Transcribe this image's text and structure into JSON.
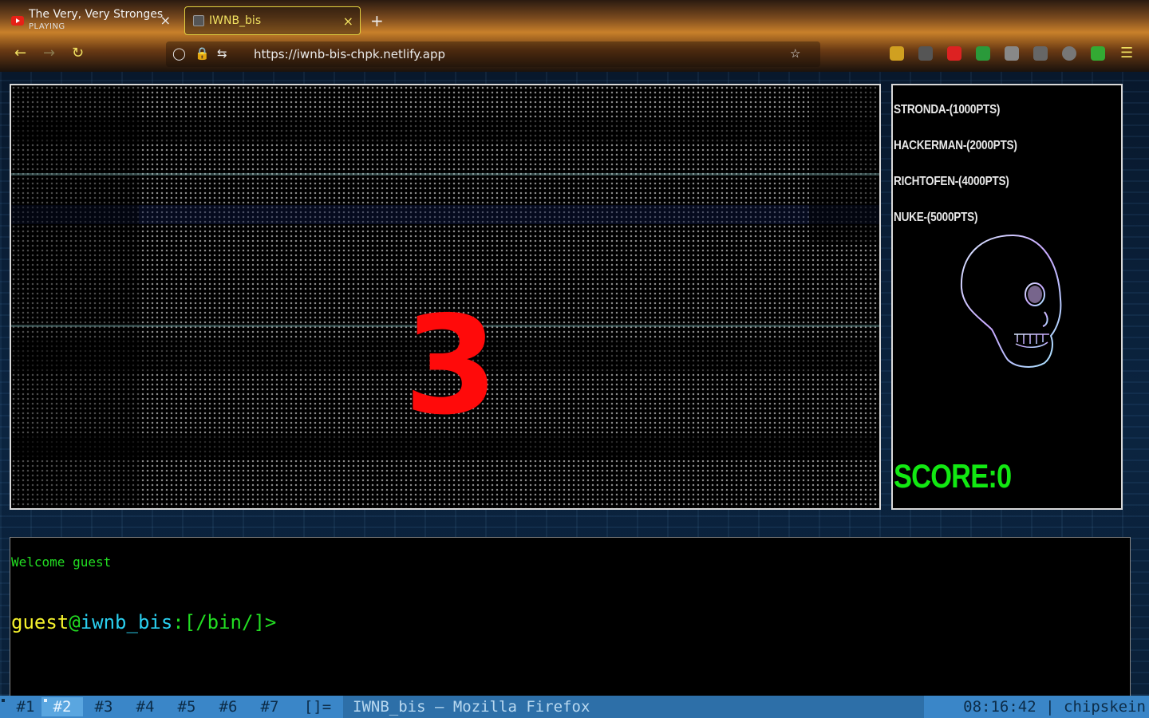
{
  "browser": {
    "tabs": [
      {
        "title": "The Very, Very Strongest!",
        "subtitle": "PLAYING",
        "close": "×"
      },
      {
        "title": "IWNB_bis",
        "close": "×"
      }
    ],
    "new_tab": "+",
    "url": "https://iwnb-bis-chpk.netlify.app"
  },
  "game": {
    "countdown": "3",
    "leaderboard": [
      "STRONDA-(1000PTS)",
      "HACKERMAN-(2000PTS)",
      "RICHTOFEN-(4000PTS)",
      "NUKE-(5000PTS)"
    ],
    "score": "SCORE:0"
  },
  "terminal": {
    "welcome": "Welcome guest",
    "prompt_user": "guest",
    "prompt_at": "@",
    "prompt_host": "iwnb_bis",
    "prompt_path": ":[/bin/]>"
  },
  "wm": {
    "workspaces": [
      "#1",
      "#2",
      "#3",
      "#4",
      "#5",
      "#6",
      "#7"
    ],
    "layout": "[]=",
    "window_title": "IWNB_bis — Mozilla Firefox",
    "clock": "08:16:42",
    "separator": "|",
    "user": "chipskein"
  },
  "colors": {
    "countdown": "#ff0a0a",
    "score": "#12e812",
    "prompt_user": "#f4f12c",
    "prompt_host": "#2ad0f0",
    "wm_bar": "#3a86c8"
  }
}
